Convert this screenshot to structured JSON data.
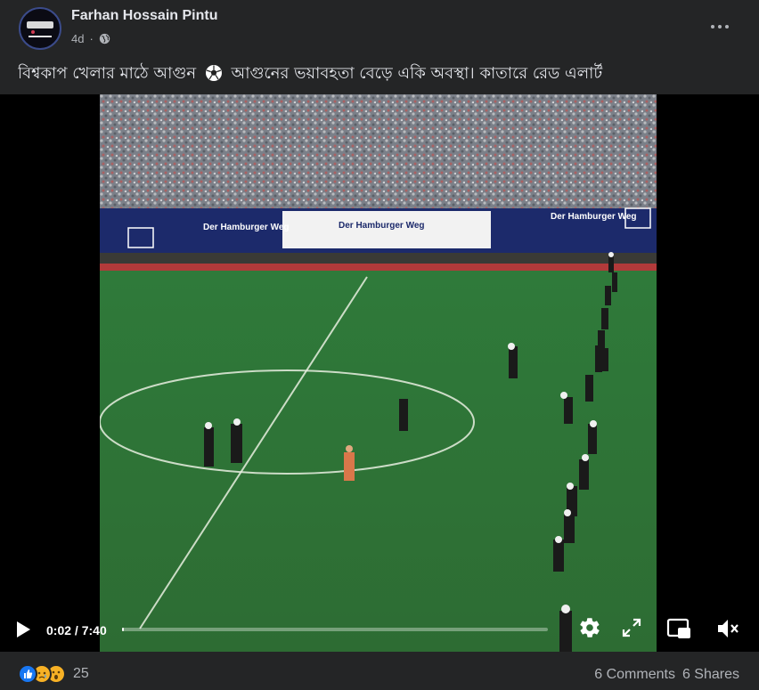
{
  "post": {
    "author": "Farhan Hossain Pintu",
    "time": "4d",
    "privacy_icon": "globe-icon",
    "caption_part1": "বিশ্বকাপ খেলার মাঠে আগুন",
    "caption_part2": "আগুনের ভয়াবহতা বেড়ে একি অবস্থা। কাতারে রেড এলার্ট",
    "caption_emoji": "soccer-ball-icon"
  },
  "video": {
    "current_time": "0:02",
    "separator": "/",
    "duration": "7:40",
    "progress": 0.004,
    "stadium_banners": [
      "Der Hamburger Weg",
      "Der Hamburger Weg",
      "Der Hamburger Weg"
    ]
  },
  "footer": {
    "reaction_count": "25",
    "comments": "6 Comments",
    "shares": "6 Shares"
  },
  "colors": {
    "background": "#242526",
    "text": "#e4e6eb",
    "muted": "#b0b3b8",
    "like_blue": "#1877f2",
    "reaction_yellow": "#f7b125"
  }
}
